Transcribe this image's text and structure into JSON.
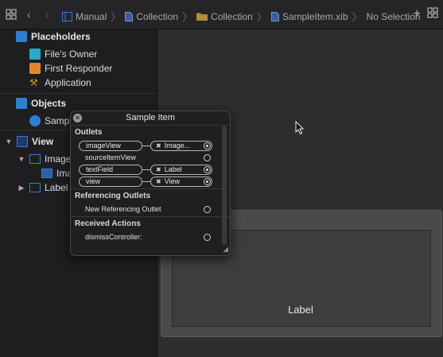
{
  "breadcrumb": {
    "items": [
      "Manual",
      "Collection",
      "Collection",
      "SampleItem.xib",
      "No Selection"
    ]
  },
  "sidebar": {
    "placeholders_header": "Placeholders",
    "placeholders": [
      "File's Owner",
      "First Responder",
      "Application"
    ],
    "objects_header": "Objects",
    "objects_item": "Sampl",
    "view_header": "View",
    "view_children": [
      "Image",
      "Ima",
      "Label"
    ]
  },
  "canvas": {
    "label_text": "Label"
  },
  "popover": {
    "title": "Sample Item",
    "outlets_header": "Outlets",
    "outlets": [
      {
        "name": "imageView",
        "target": "Image..."
      },
      {
        "name": "sourceItemView",
        "target": ""
      },
      {
        "name": "textField",
        "target": "Label"
      },
      {
        "name": "view",
        "target": "View"
      }
    ],
    "ref_header": "Referencing Outlets",
    "ref_item": "New Referencing Outlet",
    "actions_header": "Received Actions",
    "action_item": "dismissController:"
  },
  "colors": {
    "accent_blue": "#3a7bd5",
    "teal_icon": "#2fb3c9",
    "orange_icon": "#e0892c"
  }
}
